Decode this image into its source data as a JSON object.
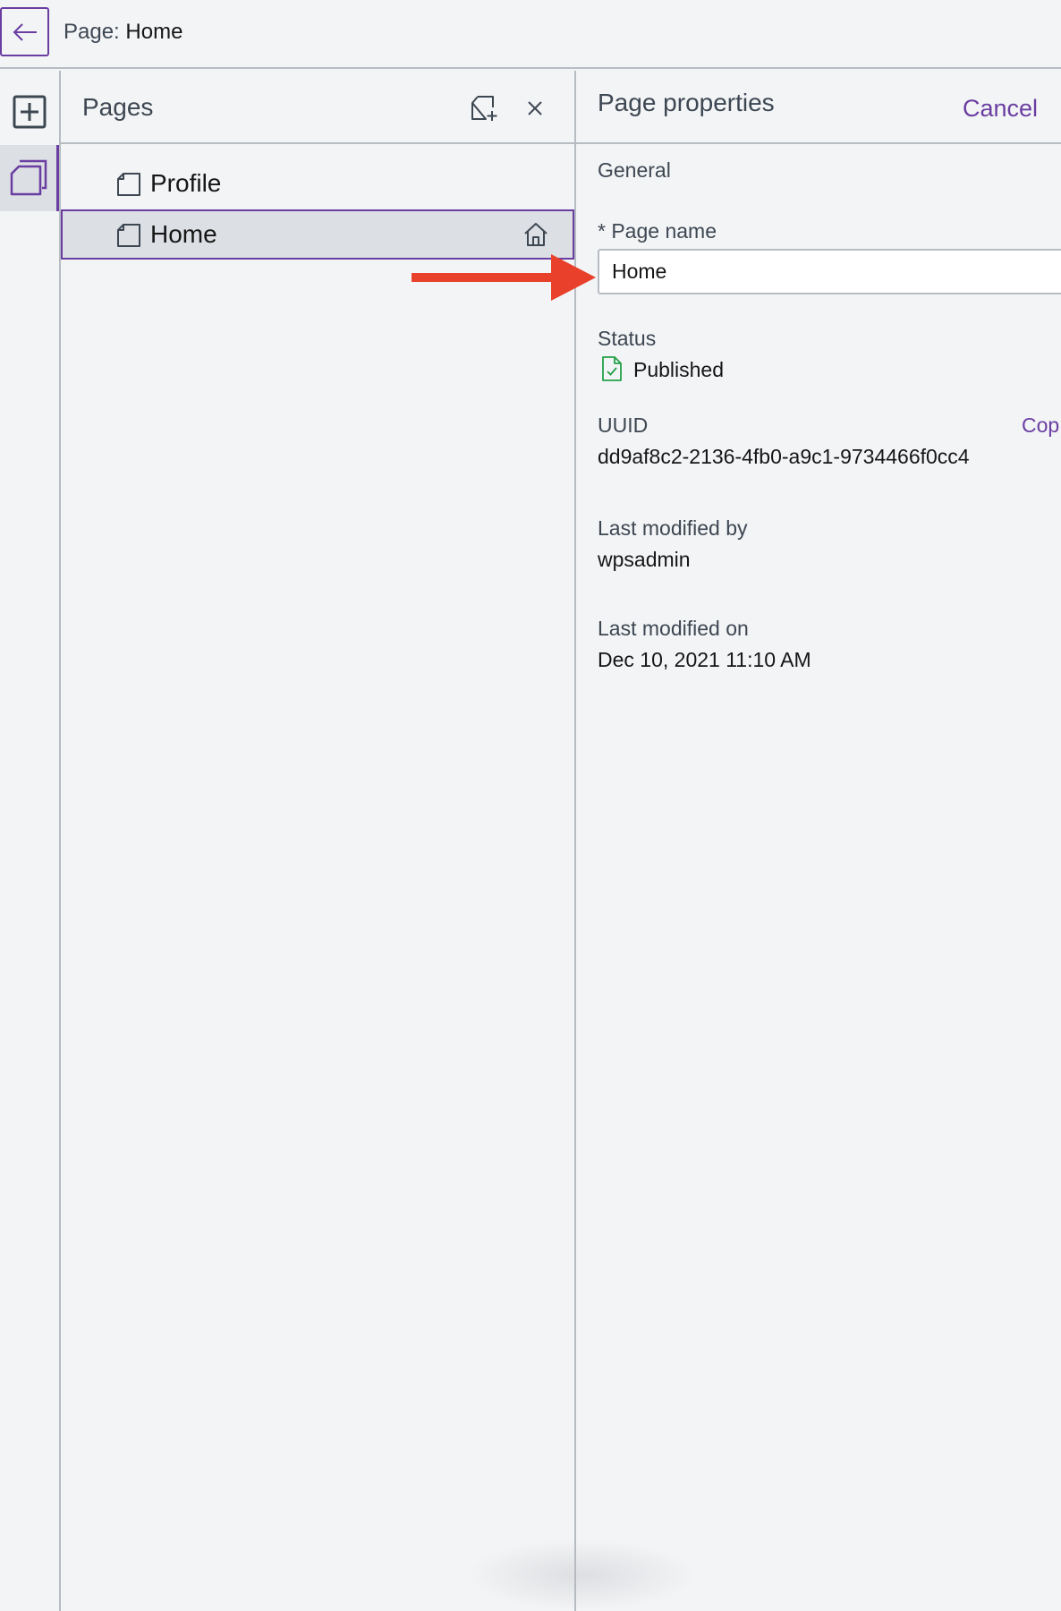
{
  "topbar": {
    "breadcrumb_label": "Page:",
    "breadcrumb_value": "Home"
  },
  "rail": {
    "items": [
      {
        "icon": "add-box-icon",
        "active": false
      },
      {
        "icon": "pages-icon",
        "active": true
      }
    ]
  },
  "pages_panel": {
    "title": "Pages",
    "pages": [
      {
        "label": "Profile",
        "selected": false,
        "is_home": false
      },
      {
        "label": "Home",
        "selected": true,
        "is_home": true
      }
    ]
  },
  "properties": {
    "title": "Page properties",
    "cancel_label": "Cancel",
    "section_general": "General",
    "page_name_label": "* Page name",
    "page_name_value": "Home",
    "status_label": "Status",
    "status_value": "Published",
    "uuid_label": "UUID",
    "uuid_value": "dd9af8c2-2136-4fb0-a9c1-9734466f0cc4",
    "copy_label": "Cop",
    "modified_by_label": "Last modified by",
    "modified_by_value": "wpsadmin",
    "modified_on_label": "Last modified on",
    "modified_on_value": "Dec 10, 2021 11:10 AM"
  },
  "colors": {
    "accent": "#6a3ea1",
    "background": "#f3f4f6",
    "border": "#b7bcc2",
    "selected_row": "#dcdfe4",
    "status_green": "#24a148",
    "annotation_arrow": "#e8402a"
  }
}
